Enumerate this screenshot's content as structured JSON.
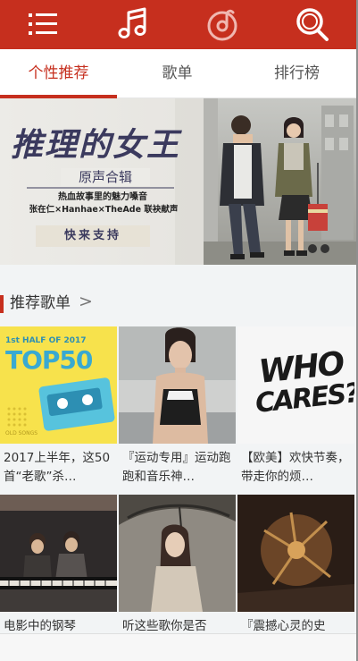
{
  "header": {
    "icons": [
      "menu-icon",
      "music-note-icon",
      "netease-logo-icon",
      "search-icon"
    ],
    "color": "#c62f1e"
  },
  "tabs": [
    {
      "label": "个性推荐",
      "active": true
    },
    {
      "label": "歌单",
      "active": false
    },
    {
      "label": "排行榜",
      "active": false
    }
  ],
  "banner": {
    "title": "推理的女王",
    "subtitle": "原声合辑",
    "line1": "热血故事里的魅力嗓音",
    "line2": "张在仁×Hanhae×TheAde 联袂献声",
    "tag": "快来支持"
  },
  "section": {
    "title": "推荐歌单",
    "arrow": ">"
  },
  "playlists": [
    {
      "title": "2017上半年，这50首“老歌”杀…",
      "cover": {
        "top_text": "1st HALF OF 2017",
        "big_text": "TOP50",
        "small_text": "OLD SONGS"
      }
    },
    {
      "title": "『运动专用』运动跑跑和音乐神…",
      "cover": {}
    },
    {
      "title": "【欧美】欢快节奏，带走你的烦…",
      "cover": {
        "text1": "WHO",
        "text2": "CARES?"
      }
    },
    {
      "title": "电影中的钢琴",
      "cover": {}
    },
    {
      "title": "听这些歌你是否",
      "cover": {}
    },
    {
      "title": "『震撼心灵的史",
      "cover": {}
    }
  ]
}
